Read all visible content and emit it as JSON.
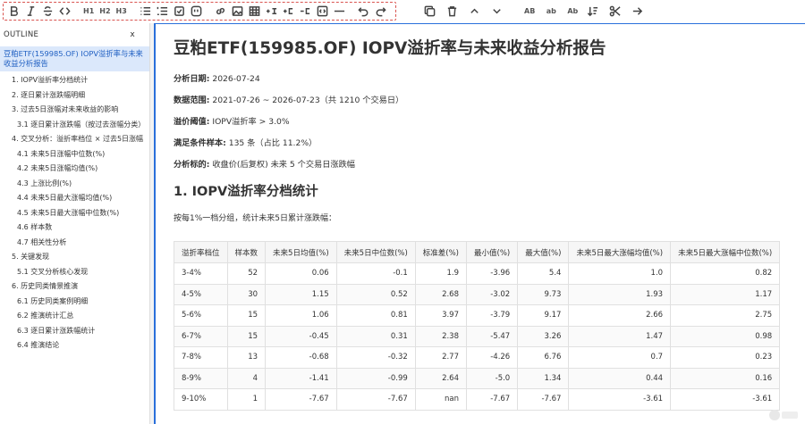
{
  "toolbar": {
    "headings": [
      "H1",
      "H2",
      "H3"
    ],
    "ab_buttons": [
      "AB",
      "ab",
      "Ab"
    ]
  },
  "sidebar": {
    "header": "OUTLINE",
    "close": "x",
    "items": [
      {
        "label": "豆粕ETF(159985.OF) IOPV溢折率与未来收益分析报告",
        "level": 0,
        "active": true
      },
      {
        "label": "1. IOPV溢折率分档统计",
        "level": 1
      },
      {
        "label": "2. 逐日累计涨跌幅明细",
        "level": 1
      },
      {
        "label": "3. 过去5日涨幅对未来收益的影响",
        "level": 1
      },
      {
        "label": "3.1 逐日累计涨跌幅（按过去涨幅分类）",
        "level": 2
      },
      {
        "label": "4. 交叉分析：溢折率档位 × 过去5日涨幅",
        "level": 1
      },
      {
        "label": "4.1 未来5日涨幅中位数(%)",
        "level": 2
      },
      {
        "label": "4.2 未来5日涨幅均值(%)",
        "level": 2
      },
      {
        "label": "4.3 上涨比例(%)",
        "level": 2
      },
      {
        "label": "4.4 未来5日最大涨幅均值(%)",
        "level": 2
      },
      {
        "label": "4.5 未来5日最大涨幅中位数(%)",
        "level": 2
      },
      {
        "label": "4.6 样本数",
        "level": 2
      },
      {
        "label": "4.7 相关性分析",
        "level": 2
      },
      {
        "label": "5. 关键发现",
        "level": 1
      },
      {
        "label": "5.1 交叉分析核心发现",
        "level": 2
      },
      {
        "label": "6. 历史同类情景推演",
        "level": 1
      },
      {
        "label": "6.1 历史同类案例明细",
        "level": 2
      },
      {
        "label": "6.2 推演统计汇总",
        "level": 2
      },
      {
        "label": "6.3 逐日累计涨跌幅统计",
        "level": 2
      },
      {
        "label": "6.4 推演结论",
        "level": 2
      }
    ]
  },
  "doc": {
    "title": "豆粕ETF(159985.OF) IOPV溢折率与未来收益分析报告",
    "meta": [
      {
        "key": "分析日期:",
        "value": " 2026-07-24"
      },
      {
        "key": "数据范围:",
        "value": " 2021-07-26 ~ 2026-07-23（共 1210 个交易日）"
      },
      {
        "key": "溢价阈值:",
        "value": " IOPV溢折率 > 3.0%"
      },
      {
        "key": "满足条件样本:",
        "value": " 135 条（占比 11.2%）"
      },
      {
        "key": "分析标的:",
        "value": " 收盘价(后复权) 未来 5 个交易日涨跌幅"
      }
    ],
    "section1_title": "1. IOPV溢折率分档统计",
    "section1_para": "按每1%一档分组，统计未来5日累计涨跌幅：",
    "table": {
      "headers": [
        "溢折率档位",
        "样本数",
        "未来5日均值(%)",
        "未来5日中位数(%)",
        "标准差(%)",
        "最小值(%)",
        "最大值(%)",
        "未来5日最大涨幅均值(%)",
        "未来5日最大涨幅中位数(%)"
      ],
      "rows": [
        [
          "3-4%",
          "52",
          "0.06",
          "-0.1",
          "1.9",
          "-3.96",
          "5.4",
          "1.0",
          "0.82"
        ],
        [
          "4-5%",
          "30",
          "1.15",
          "0.52",
          "2.68",
          "-3.02",
          "9.73",
          "1.93",
          "1.17"
        ],
        [
          "5-6%",
          "15",
          "1.06",
          "0.81",
          "3.97",
          "-3.79",
          "9.17",
          "2.66",
          "2.75"
        ],
        [
          "6-7%",
          "15",
          "-0.45",
          "0.31",
          "2.38",
          "-5.47",
          "3.26",
          "1.47",
          "0.98"
        ],
        [
          "7-8%",
          "13",
          "-0.68",
          "-0.32",
          "2.77",
          "-4.26",
          "6.76",
          "0.7",
          "0.23"
        ],
        [
          "8-9%",
          "4",
          "-1.41",
          "-0.99",
          "2.64",
          "-5.0",
          "1.34",
          "0.44",
          "0.16"
        ],
        [
          "9-10%",
          "1",
          "-7.67",
          "-7.67",
          "nan",
          "-7.67",
          "-7.67",
          "-3.61",
          "-3.61"
        ]
      ]
    }
  }
}
